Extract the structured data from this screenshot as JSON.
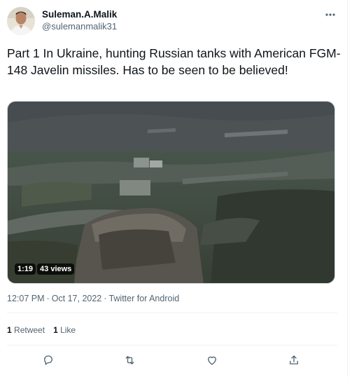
{
  "author": {
    "display_name": "Suleman.A.Malik",
    "handle": "@sulemanmalik31"
  },
  "tweet": {
    "text": "Part 1 In Ukraine, hunting Russian tanks with American FGM- 148 Javelin missiles. Has to be seen to be believed!"
  },
  "video": {
    "duration": "1:19",
    "views": "43 views"
  },
  "meta": {
    "time": "12:07 PM",
    "separator": "·",
    "date": "Oct 17, 2022",
    "source": "Twitter for Android"
  },
  "stats": {
    "retweets_count": "1",
    "retweets_label": "Retweet",
    "likes_count": "1",
    "likes_label": "Like"
  },
  "icons": {
    "more": "more-dots-icon",
    "reply": "reply-icon",
    "retweet": "retweet-icon",
    "like": "heart-icon",
    "share": "share-icon"
  },
  "colors": {
    "text_primary": "#0f1419",
    "text_secondary": "#536471",
    "border": "#eff3f4"
  }
}
